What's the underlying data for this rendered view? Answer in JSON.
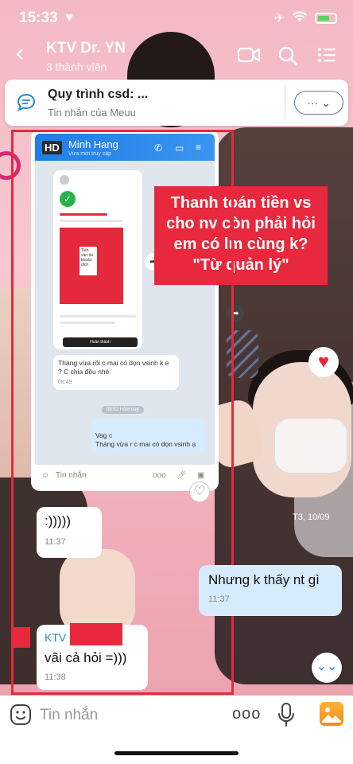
{
  "status": {
    "time": "15:33"
  },
  "header": {
    "title": "KTV Dr. YN",
    "subtitle": "3 thành viên",
    "back": "‹"
  },
  "pinned": {
    "title": "Quy trình csd: ...",
    "subtitle": "Tin nhắn của Meuu",
    "more_label": "··· ⌄"
  },
  "embedded": {
    "hd_badge": "HD",
    "contact_name": "Minh Hang",
    "contact_status": "Vừa mới truy cập",
    "card_text": "Tiền vào tài khoản",
    "card_sub": "dịch",
    "card_button": "Hoàn thành",
    "msg1_text": "Tháng vừa rồi c mai có dọn vsinh k e ? C chia đều nhé",
    "msg1_time": "08:49",
    "date_chip": "08:52 Hôm nay",
    "msg2_text": "Vag c\nTháng vừa r c mai có dọn vsinh ạ",
    "input_placeholder": "Tin nhắn"
  },
  "overlay_note": "Thanh toán tiền vs\ncho nv còn phải hỏi\nem có lm cùng k?\n\"Từ quản lý\"",
  "video_stamp": "T3, 10/09",
  "messages": [
    {
      "text": ":)))))",
      "time": "11:37"
    },
    {
      "text": "Nhưng k thấy nt gì",
      "time": "11:37"
    },
    {
      "sender": "KTV",
      "text": "vãi cả hỏi =)))",
      "time": "11:38"
    }
  ],
  "composer": {
    "placeholder": "Tin nhắn",
    "more": "ooo"
  },
  "colors": {
    "accent_red": "#e8283c",
    "zalo_blue": "#1f8ad6",
    "bubble_mine": "#d6ebfc"
  }
}
